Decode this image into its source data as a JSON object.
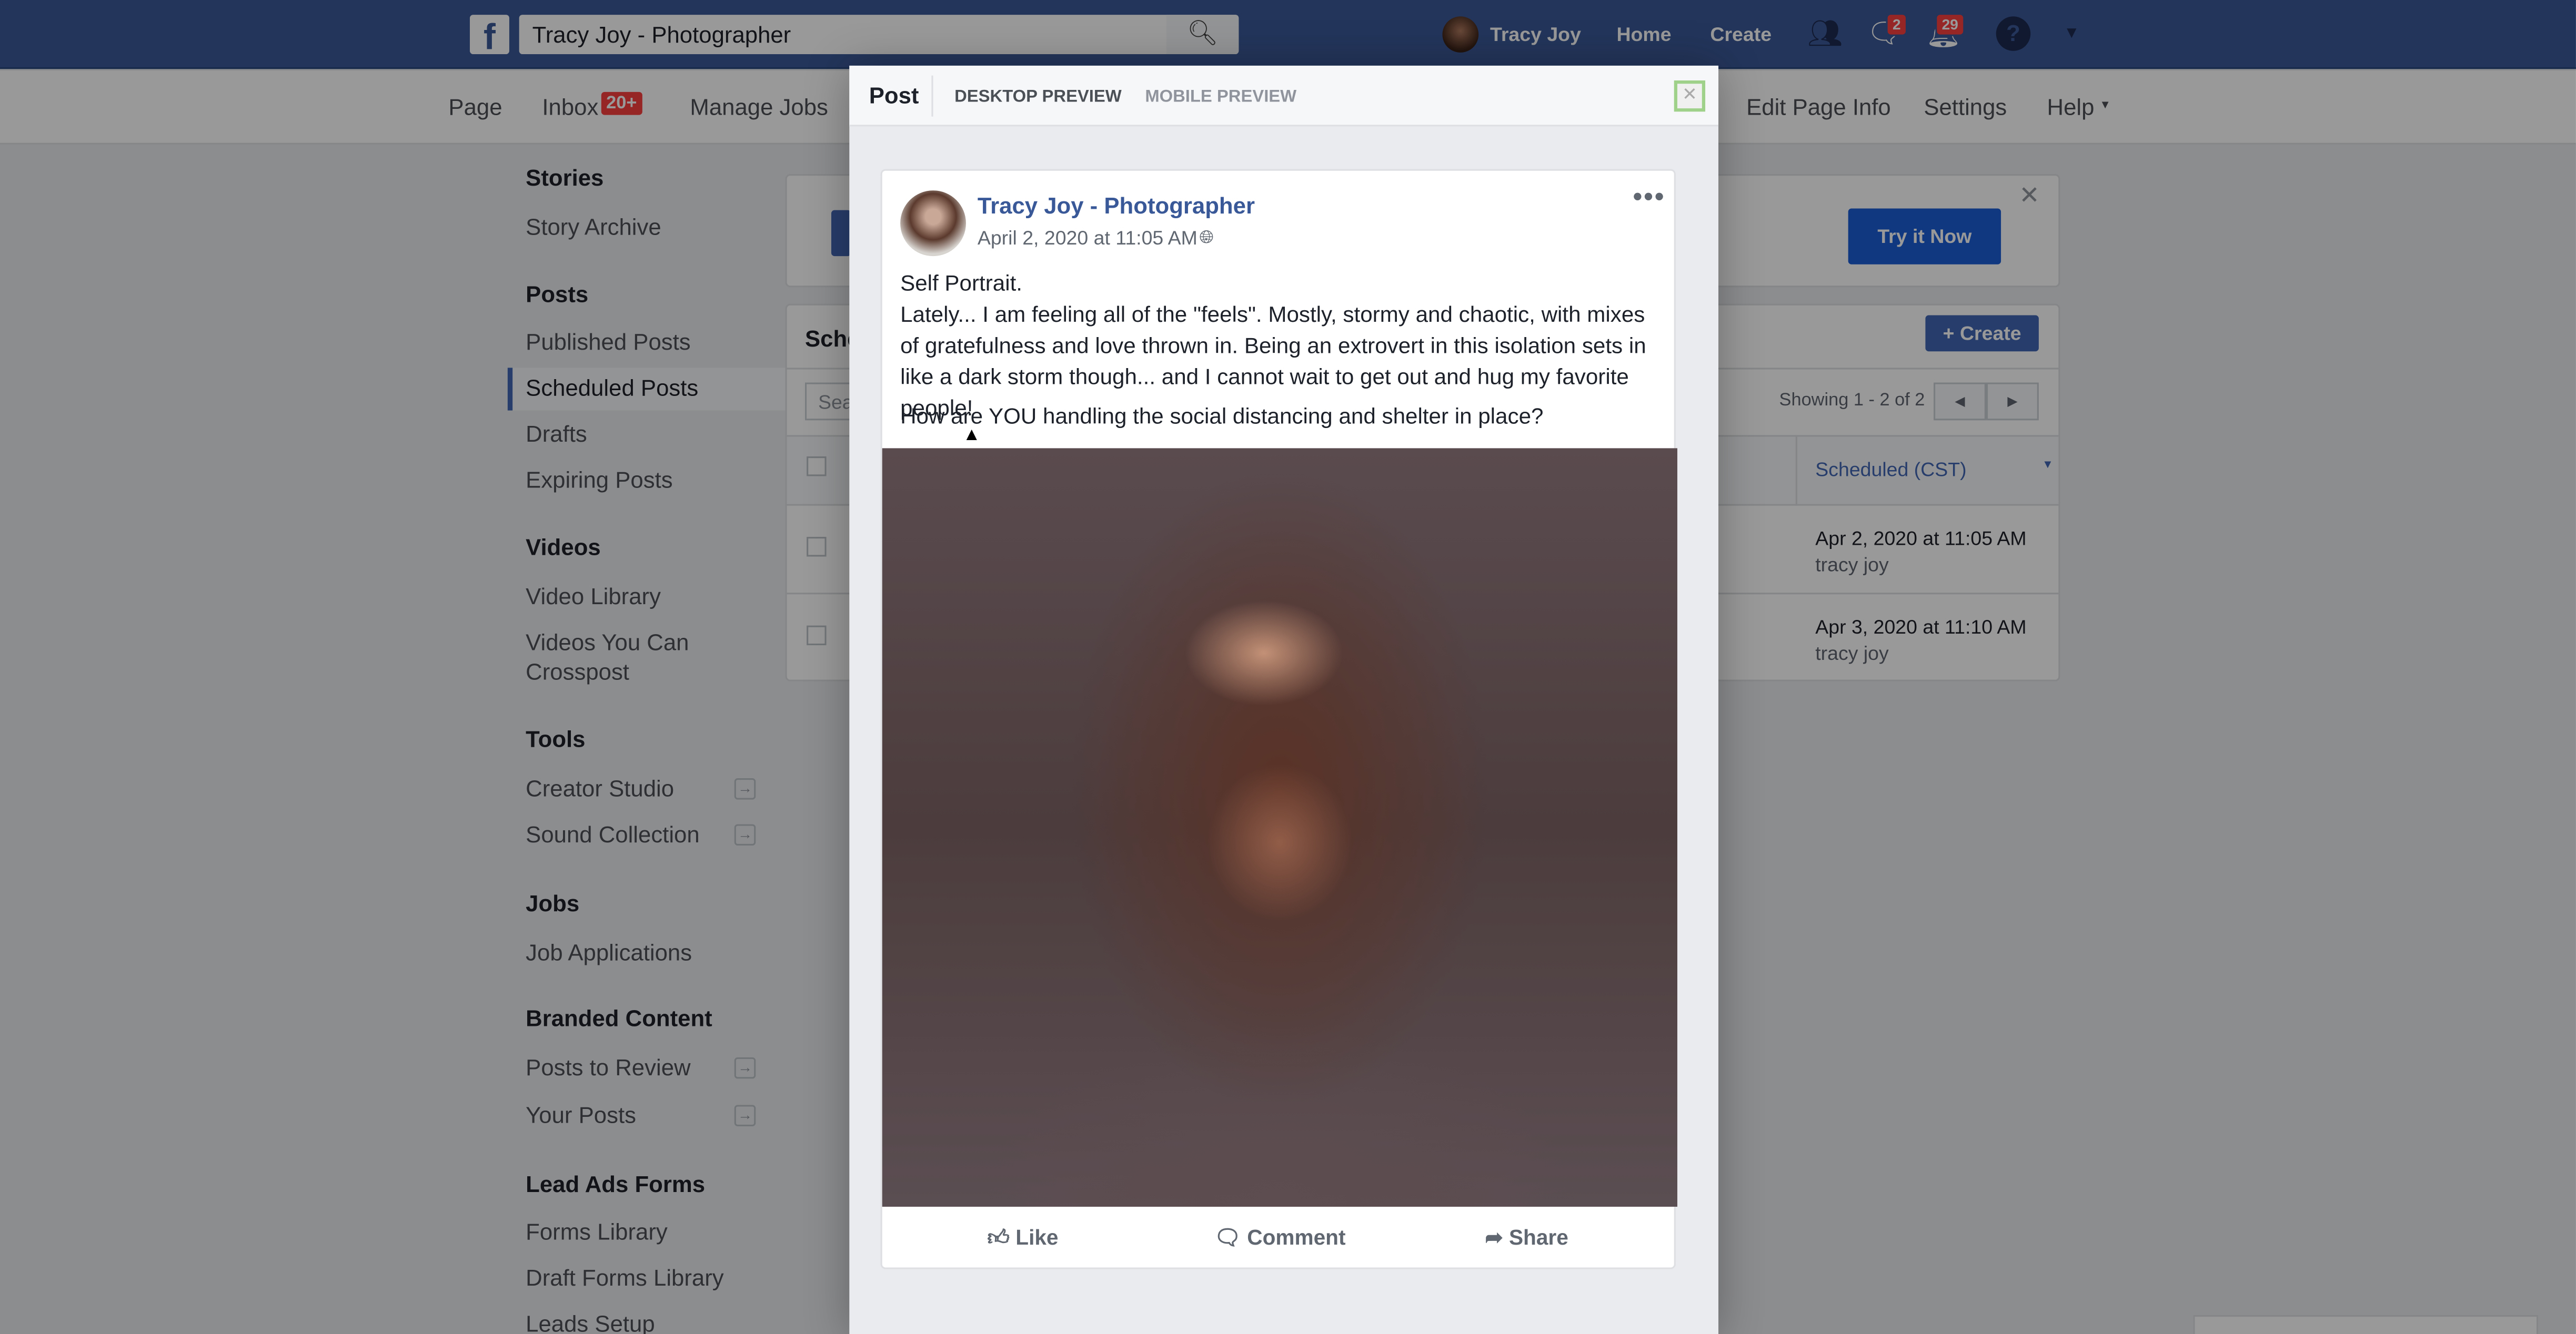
{
  "topbar": {
    "search_value": "Tracy Joy - Photographer",
    "user": "Tracy Joy",
    "home": "Home",
    "create": "Create",
    "messages_badge": "2",
    "notifications_badge": "29",
    "brand_color": "#3b5998"
  },
  "subnav": {
    "page": "Page",
    "inbox": "Inbox",
    "inbox_badge": "20+",
    "manage_jobs": "Manage Jobs",
    "edit_page_info": "Edit Page Info",
    "settings": "Settings",
    "help": "Help"
  },
  "sidebar": {
    "groups": [
      {
        "title": "Stories",
        "items": [
          "Story Archive"
        ]
      },
      {
        "title": "Posts",
        "items": [
          "Published Posts",
          "Scheduled Posts",
          "Drafts",
          "Expiring Posts"
        ],
        "selected": "Scheduled Posts"
      },
      {
        "title": "Videos",
        "items": [
          "Video Library",
          "Videos You Can Crosspost"
        ]
      },
      {
        "title": "Tools",
        "items": [
          "Creator Studio",
          "Sound Collection"
        ]
      },
      {
        "title": "Jobs",
        "items": [
          "Job Applications"
        ]
      },
      {
        "title": "Branded Content",
        "items": [
          "Posts to Review",
          "Your Posts"
        ]
      },
      {
        "title": "Lead Ads Forms",
        "items": [
          "Forms Library",
          "Draft Forms Library",
          "Leads Setup"
        ]
      }
    ]
  },
  "banner": {
    "try_button": "Try it Now"
  },
  "scheduled": {
    "title": "Sche",
    "create_button": "Create",
    "search_placeholder": "Sea",
    "showing": "Showing 1 - 2 of 2",
    "column": "Scheduled (CST)",
    "rows": [
      {
        "date": "Apr 2, 2020 at 11:05 AM",
        "author": "tracy joy"
      },
      {
        "date": "Apr 3, 2020 at 11:10 AM",
        "author": "tracy joy"
      }
    ]
  },
  "modal": {
    "tabs": [
      "Post",
      "DESKTOP PREVIEW",
      "MOBILE PREVIEW"
    ],
    "active_tab": "Post",
    "post": {
      "page_name": "Tracy Joy - Photographer",
      "timestamp": "April 2, 2020 at 11:05 AM ·",
      "privacy_icon": "globe-icon",
      "lines": [
        "Self Portrait.",
        "Lately... I am feeling all of the \"feels\". Mostly, stormy and chaotic, with mixes of gratefulness and love thrown in. Being an extrovert in this isolation sets in like a dark storm though... and I cannot wait to get out and hug my favorite people!",
        "How are YOU handling the social distancing and shelter in place?"
      ],
      "actions": [
        "Like",
        "Comment",
        "Share"
      ]
    }
  }
}
